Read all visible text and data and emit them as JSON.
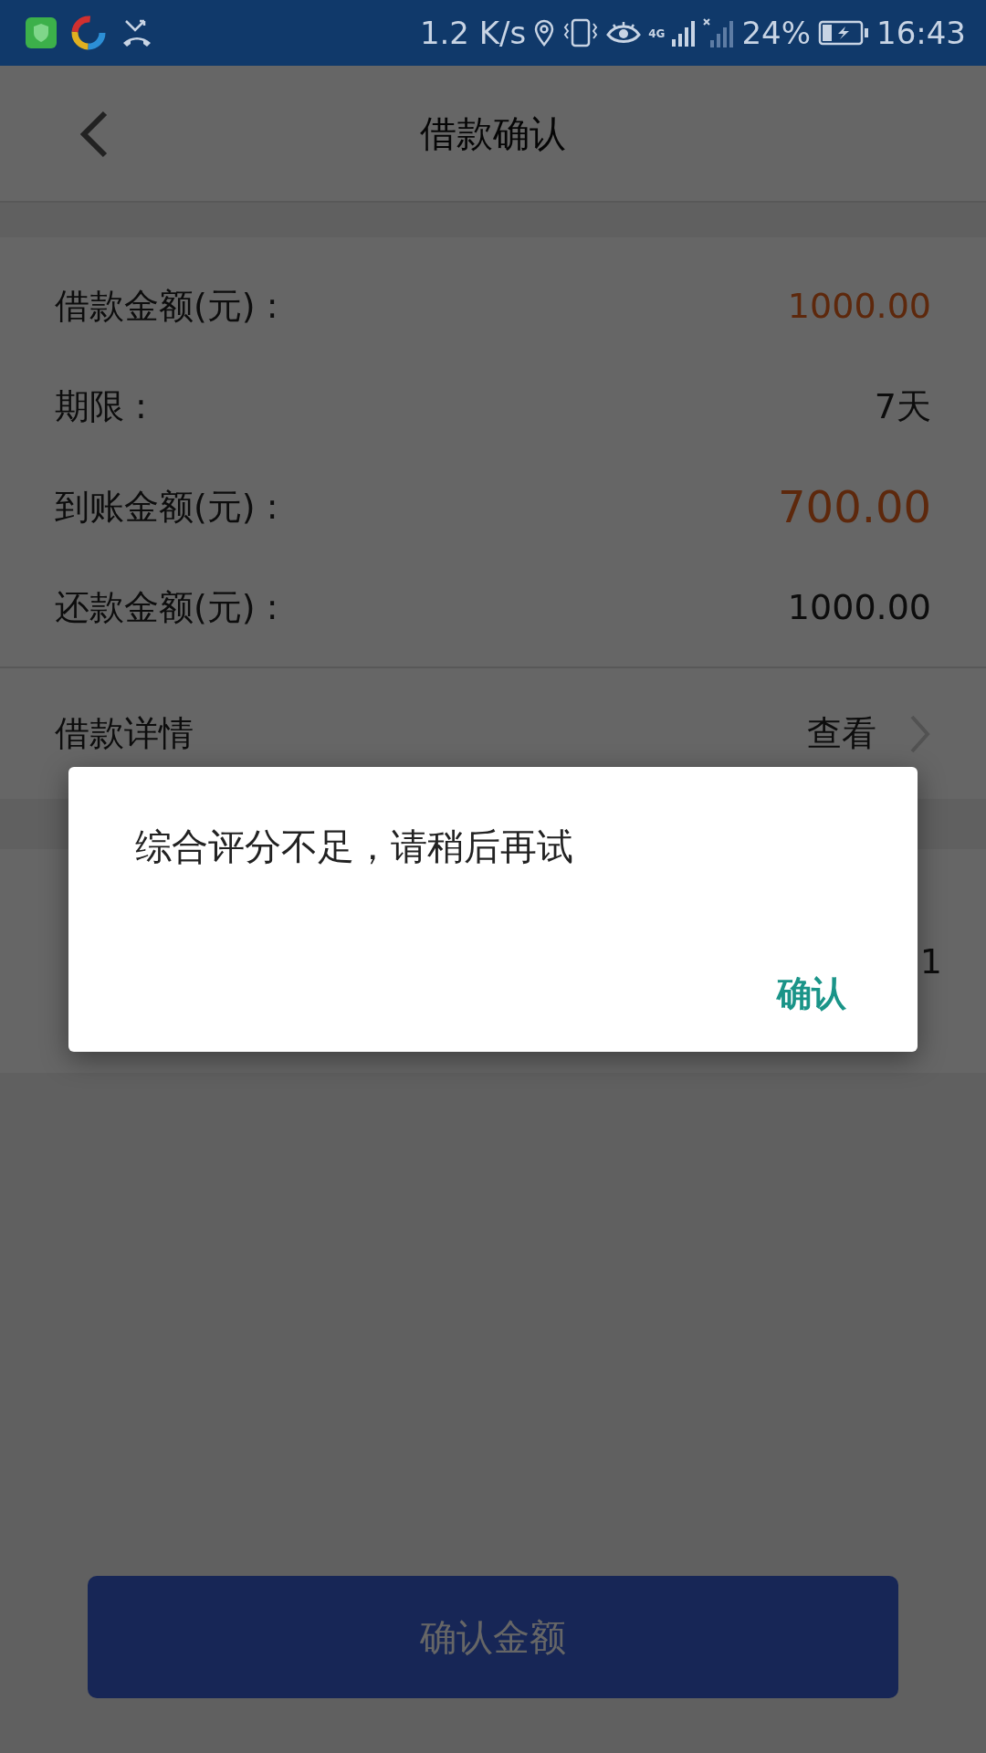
{
  "status_bar": {
    "speed": "1.2 K/s",
    "network": "4G",
    "battery": "24%",
    "time": "16:43"
  },
  "header": {
    "title": "借款确认"
  },
  "summary": [
    {
      "label": "借款金额(元) :",
      "value": "1000.00",
      "kind": "accent"
    },
    {
      "label": "期限 :",
      "value": "7天",
      "kind": "plain"
    },
    {
      "label": "到账金额(元) :",
      "value": "700.00",
      "kind": "highlight"
    },
    {
      "label": "还款金额(元) :",
      "value": "1000.00",
      "kind": "plain"
    }
  ],
  "detail": {
    "label": "借款详情",
    "action": "查看"
  },
  "second_card": {
    "value": "1"
  },
  "dialog": {
    "message": "综合评分不足，请稍后再试",
    "button": "确认"
  },
  "confirm_button": "确认金额"
}
